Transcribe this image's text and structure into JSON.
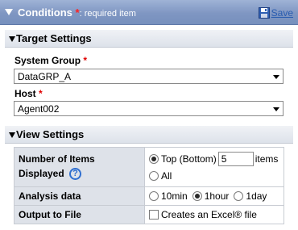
{
  "header": {
    "title": "Conditions",
    "required_mark": "*",
    "required_text": ": required item",
    "save_label": "Save"
  },
  "target_settings": {
    "section_label": "Target Settings",
    "system_group": {
      "label": "System Group",
      "required_mark": "*",
      "value": "DataGRP_A"
    },
    "host": {
      "label": "Host",
      "required_mark": "*",
      "value": "Agent002"
    }
  },
  "view_settings": {
    "section_label": "View Settings",
    "items_displayed": {
      "label_line1": "Number of Items",
      "label_line2": "Displayed",
      "option_top": "Top (Bottom)",
      "top_value": "5",
      "items_unit": "items",
      "option_all": "All",
      "selected": "top"
    },
    "analysis_data": {
      "label": "Analysis data",
      "options": [
        "10min",
        "1hour",
        "1day"
      ],
      "selected": "1hour"
    },
    "output_to_file": {
      "label": "Output to File",
      "checkbox_label": "Creates an Excel® file",
      "checked": false
    }
  }
}
